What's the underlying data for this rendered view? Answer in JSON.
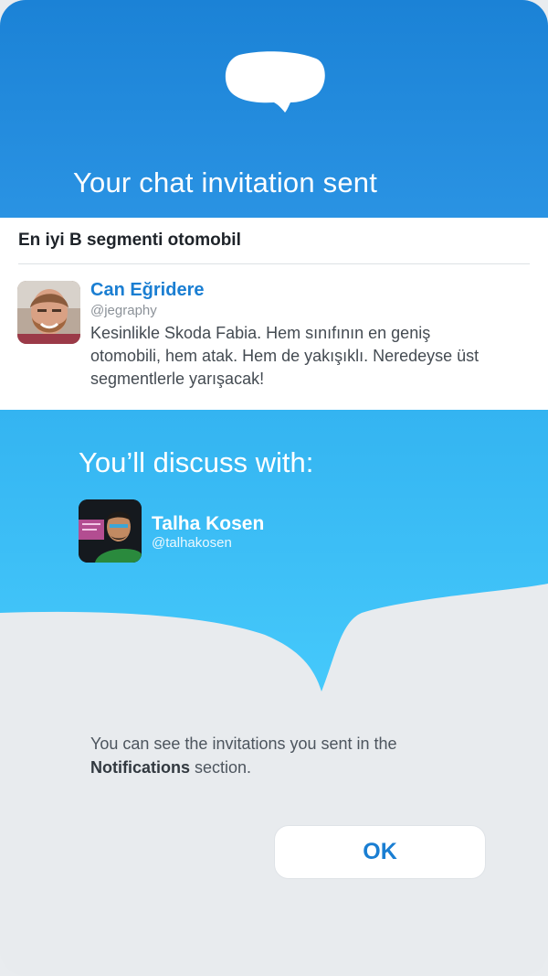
{
  "header": {
    "title": "Your chat invitation sent",
    "colors": {
      "top": "#1b82d6",
      "bottom": "#2a93e3"
    },
    "icon": "speech-bubble-icon"
  },
  "topic": {
    "title": "En iyi B segmenti otomobil"
  },
  "post": {
    "author_name": "Can Eğridere",
    "author_handle": "@jegraphy",
    "text": "Kesinlikle Skoda Fabia. Hem sınıfının en geniş otomobili, hem atak. Hem de yakışıklı. Neredeyse üst segmentlerle yarışacak!"
  },
  "discuss": {
    "title": "You’ll discuss with:",
    "user_name": "Talha Kosen",
    "user_handle": "@talhakosen",
    "bubble_color_top": "#34b4f1",
    "bubble_color_bottom": "#45c9fb"
  },
  "info": {
    "prefix": "You can see the invitations you sent in the ",
    "bold": "Notifications",
    "suffix": " section."
  },
  "ok_button": {
    "label": "OK"
  },
  "accent_color": "#1a7ed2"
}
